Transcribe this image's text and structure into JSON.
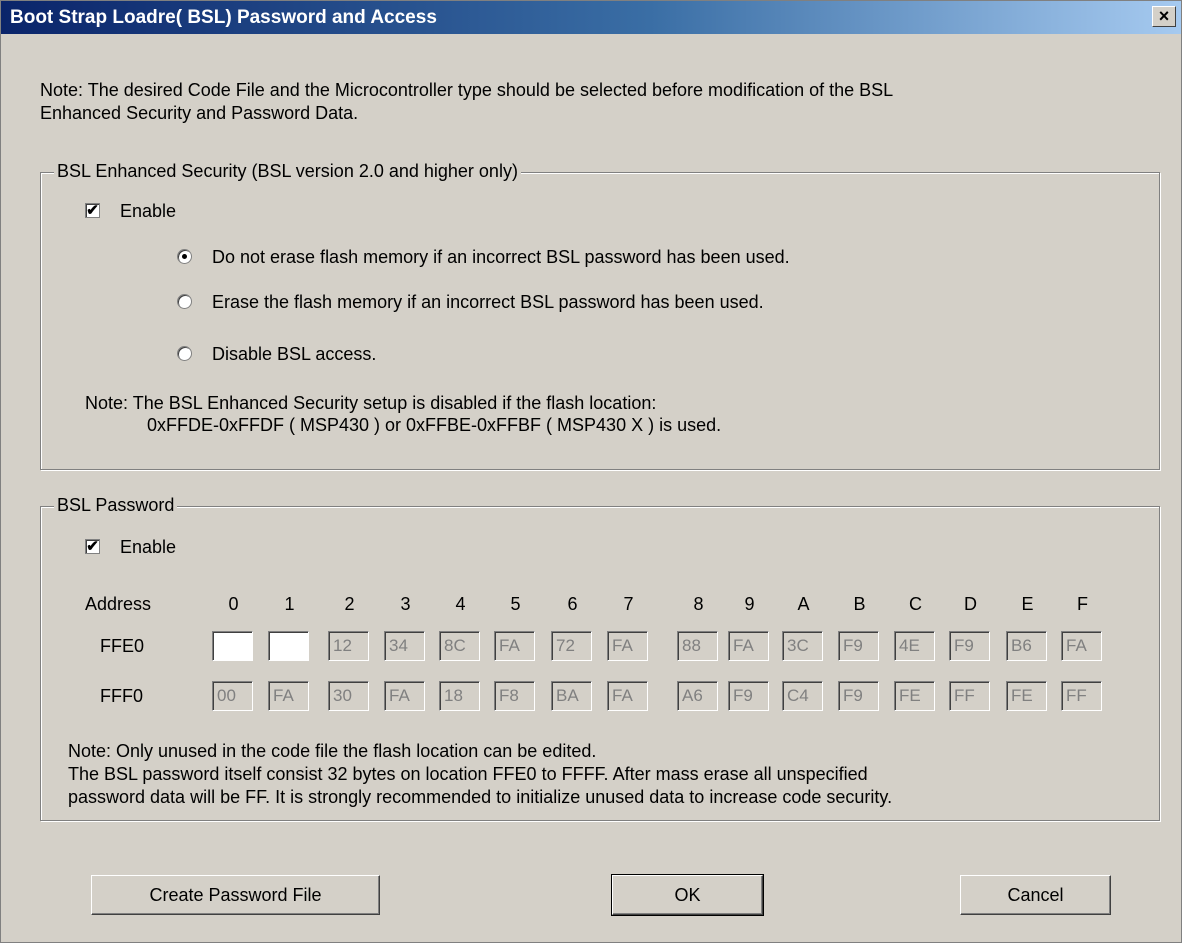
{
  "window": {
    "title": "Boot Strap Loadre( BSL) Password and Access",
    "close_glyph": "×"
  },
  "note_top": {
    "line1": "Note: The desired Code File and the Microcontroller type should be selected  before modification of the BSL",
    "line2": "Enhanced Security and Password Data."
  },
  "security": {
    "legend": "BSL Enhanced Security   (BSL version 2.0 and higher only)",
    "enable_label": "Enable",
    "enable_checked": true,
    "options": [
      {
        "label": "Do not erase flash memory if an incorrect BSL password has been used.",
        "selected": true
      },
      {
        "label": "Erase the flash memory if an incorrect BSL password has been used.",
        "selected": false
      },
      {
        "label": "Disable BSL access.",
        "selected": false
      }
    ],
    "note_line1": "Note: The BSL Enhanced Security setup is disabled if the flash location:",
    "note_line2": "0xFFDE-0xFFDF  ( MSP430 ) or  0xFFBE-0xFFBF ( MSP430 X )  is used."
  },
  "password": {
    "legend": "BSL Password",
    "enable_label": "Enable",
    "enable_checked": true,
    "address_label": "Address",
    "columns": [
      "0",
      "1",
      "2",
      "3",
      "4",
      "5",
      "6",
      "7",
      "8",
      "9",
      "A",
      "B",
      "C",
      "D",
      "E",
      "F"
    ],
    "rows": [
      {
        "address": "FFE0",
        "values": [
          "",
          "",
          "12",
          "34",
          "8C",
          "FA",
          "72",
          "FA",
          "88",
          "FA",
          "3C",
          "F9",
          "4E",
          "F9",
          "B6",
          "FA"
        ],
        "editable": [
          true,
          true,
          false,
          false,
          false,
          false,
          false,
          false,
          false,
          false,
          false,
          false,
          false,
          false,
          false,
          false
        ]
      },
      {
        "address": "FFF0",
        "values": [
          "00",
          "FA",
          "30",
          "FA",
          "18",
          "F8",
          "BA",
          "FA",
          "A6",
          "F9",
          "C4",
          "F9",
          "FE",
          "FF",
          "FE",
          "FF"
        ],
        "editable": [
          false,
          false,
          false,
          false,
          false,
          false,
          false,
          false,
          false,
          false,
          false,
          false,
          false,
          false,
          false,
          false
        ]
      }
    ],
    "note_line1": "Note: Only unused in the code file the flash location can be edited.",
    "note_line2": "The BSL password itself consist 32 bytes on location FFE0 to FFFF. After mass erase all unspecified",
    "note_line3": "password data will be FF. It is strongly recommended to initialize unused data to increase code security."
  },
  "buttons": {
    "create": "Create Password File",
    "ok": "OK",
    "cancel": "Cancel"
  }
}
